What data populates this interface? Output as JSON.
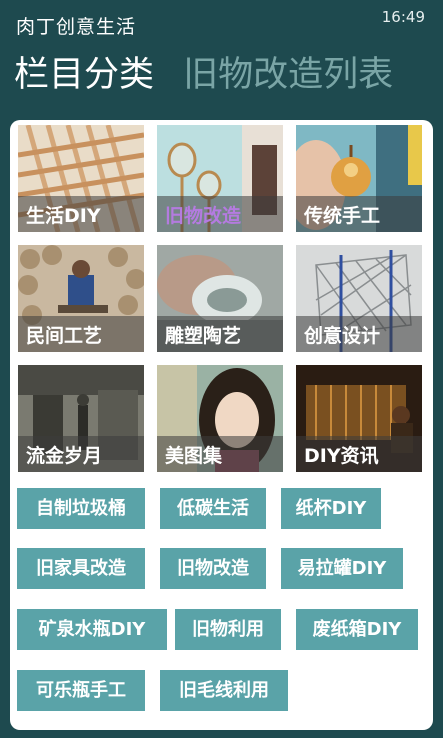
{
  "app": {
    "title": "肉丁创意生活",
    "time": "16:49"
  },
  "pivot": {
    "items": [
      "栏目分类",
      "旧物改造列表"
    ]
  },
  "tiles": [
    {
      "label": "生活DIY",
      "accent": "#ffffff"
    },
    {
      "label": "旧物改造",
      "accent": "#b47be0"
    },
    {
      "label": "传统手工",
      "accent": "#ffffff"
    },
    {
      "label": "民间工艺",
      "accent": "#ffffff"
    },
    {
      "label": "雕塑陶艺",
      "accent": "#ffffff"
    },
    {
      "label": "创意设计",
      "accent": "#ffffff"
    },
    {
      "label": "流金岁月",
      "accent": "#ffffff"
    },
    {
      "label": "美图集",
      "accent": "#ffffff"
    },
    {
      "label": "DIY资讯",
      "accent": "#ffffff"
    }
  ],
  "tags": [
    "自制垃圾桶",
    "低碳生活",
    "纸杯DIY",
    "旧家具改造",
    "旧物改造",
    "易拉罐DIY",
    "矿泉水瓶DIY",
    "旧物利用",
    "废纸箱DIY",
    "可乐瓶手工",
    "旧毛线利用"
  ],
  "colors": {
    "background": "#1e4a4f",
    "tag": "#5aa3a8",
    "panel": "#ffffff"
  }
}
